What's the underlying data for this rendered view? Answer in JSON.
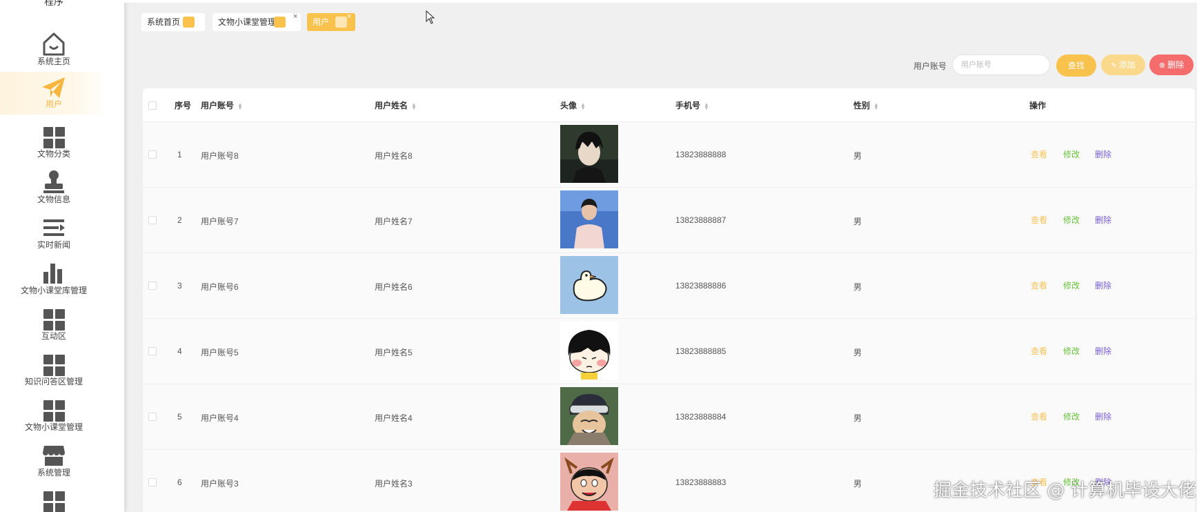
{
  "sidebar": {
    "brand": "程序",
    "items": [
      {
        "label": "系统主页",
        "icon": "home-icon"
      },
      {
        "label": "用户",
        "icon": "paper-plane-icon",
        "active": true
      },
      {
        "label": "文物分类",
        "icon": "grid-icon"
      },
      {
        "label": "文物信息",
        "icon": "stamp-icon"
      },
      {
        "label": "实时新闻",
        "icon": "list-indent-icon"
      },
      {
        "label": "文物小课堂库管理",
        "icon": "bar-chart-icon"
      },
      {
        "label": "互动区",
        "icon": "grid-icon"
      },
      {
        "label": "知识问答区管理",
        "icon": "grid-icon"
      },
      {
        "label": "文物小课堂管理",
        "icon": "grid-icon"
      },
      {
        "label": "系统管理",
        "icon": "shop-icon"
      },
      {
        "label": "",
        "icon": "grid-icon"
      }
    ]
  },
  "tabs": [
    {
      "label": "系统首页"
    },
    {
      "label": "文物小课堂管理",
      "close": "×"
    },
    {
      "label": "用户",
      "close": "×",
      "active": true
    }
  ],
  "search": {
    "label": "用户账号",
    "placeholder": "用户账号",
    "find_label": "查找",
    "add_label": "添加",
    "delete_label": "删除"
  },
  "table": {
    "headers": {
      "index": "序号",
      "account": "用户账号",
      "name": "用户姓名",
      "avatar": "头像",
      "phone": "手机号",
      "gender": "性别",
      "actions": "操作"
    },
    "rows": [
      {
        "index": "1",
        "account": "用户账号8",
        "name": "用户姓名8",
        "phone": "13823888888",
        "gender": "男"
      },
      {
        "index": "2",
        "account": "用户账号7",
        "name": "用户姓名7",
        "phone": "13823888887",
        "gender": "男"
      },
      {
        "index": "3",
        "account": "用户账号6",
        "name": "用户姓名6",
        "phone": "13823888886",
        "gender": "男"
      },
      {
        "index": "4",
        "account": "用户账号5",
        "name": "用户姓名5",
        "phone": "13823888885",
        "gender": "男"
      },
      {
        "index": "5",
        "account": "用户账号4",
        "name": "用户姓名4",
        "phone": "13823888884",
        "gender": "男"
      },
      {
        "index": "6",
        "account": "用户账号3",
        "name": "用户姓名3",
        "phone": "13823888883",
        "gender": "男"
      }
    ],
    "row_actions": {
      "view": "查看",
      "edit": "修改",
      "delete": "删除"
    }
  },
  "watermark": "掘金技术社区 @ 计算机毕设大佬",
  "colors": {
    "accent": "#f9c24d",
    "danger": "#f56c6c",
    "edit": "#67c23a",
    "delete": "#7a5fd0"
  }
}
